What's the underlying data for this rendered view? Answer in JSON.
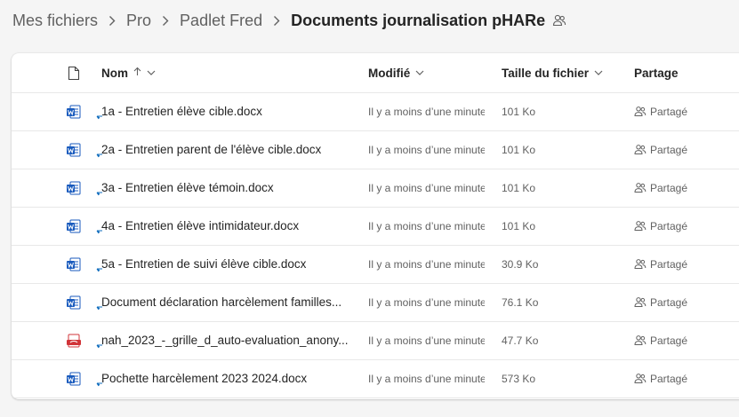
{
  "breadcrumb": {
    "items": [
      "Mes fichiers",
      "Pro",
      "Padlet Fred"
    ],
    "current": "Documents journalisation pHARe"
  },
  "table": {
    "headers": {
      "name": "Nom",
      "modified": "Modifié",
      "size": "Taille du fichier",
      "sharing": "Partage"
    },
    "rows": [
      {
        "name": "1a - Entretien élève cible.docx",
        "type": "word-icon",
        "modified": "Il y a moins d’une minute",
        "size": "101 Ko",
        "sharing": "Partagé"
      },
      {
        "name": "2a - Entretien parent de l'élève cible.docx",
        "type": "word-icon",
        "modified": "Il y a moins d’une minute",
        "size": "101 Ko",
        "sharing": "Partagé"
      },
      {
        "name": "3a - Entretien élève témoin.docx",
        "type": "word-icon",
        "modified": "Il y a moins d’une minute",
        "size": "101 Ko",
        "sharing": "Partagé"
      },
      {
        "name": "4a - Entretien élève intimidateur.docx",
        "type": "word-icon",
        "modified": "Il y a moins d’une minute",
        "size": "101 Ko",
        "sharing": "Partagé"
      },
      {
        "name": "5a - Entretien de suivi élève cible.docx",
        "type": "word-icon",
        "modified": "Il y a moins d’une minute",
        "size": "30.9 Ko",
        "sharing": "Partagé"
      },
      {
        "name": "Document déclaration harcèlement familles...",
        "type": "word-icon",
        "modified": "Il y a moins d’une minute",
        "size": "76.1 Ko",
        "sharing": "Partagé"
      },
      {
        "name": "nah_2023_-_grille_d_auto-evaluation_anony...",
        "type": "pdf-icon",
        "modified": "Il y a moins d’une minute",
        "size": "47.7 Ko",
        "sharing": "Partagé"
      },
      {
        "name": "Pochette harcèlement 2023 2024.docx",
        "type": "word-icon",
        "modified": "Il y a moins d’une minute",
        "size": "573 Ko",
        "sharing": "Partagé"
      }
    ]
  },
  "colors": {
    "word": "#185abd",
    "pdf": "#d13438",
    "new_marker": "#0f6cbd"
  }
}
